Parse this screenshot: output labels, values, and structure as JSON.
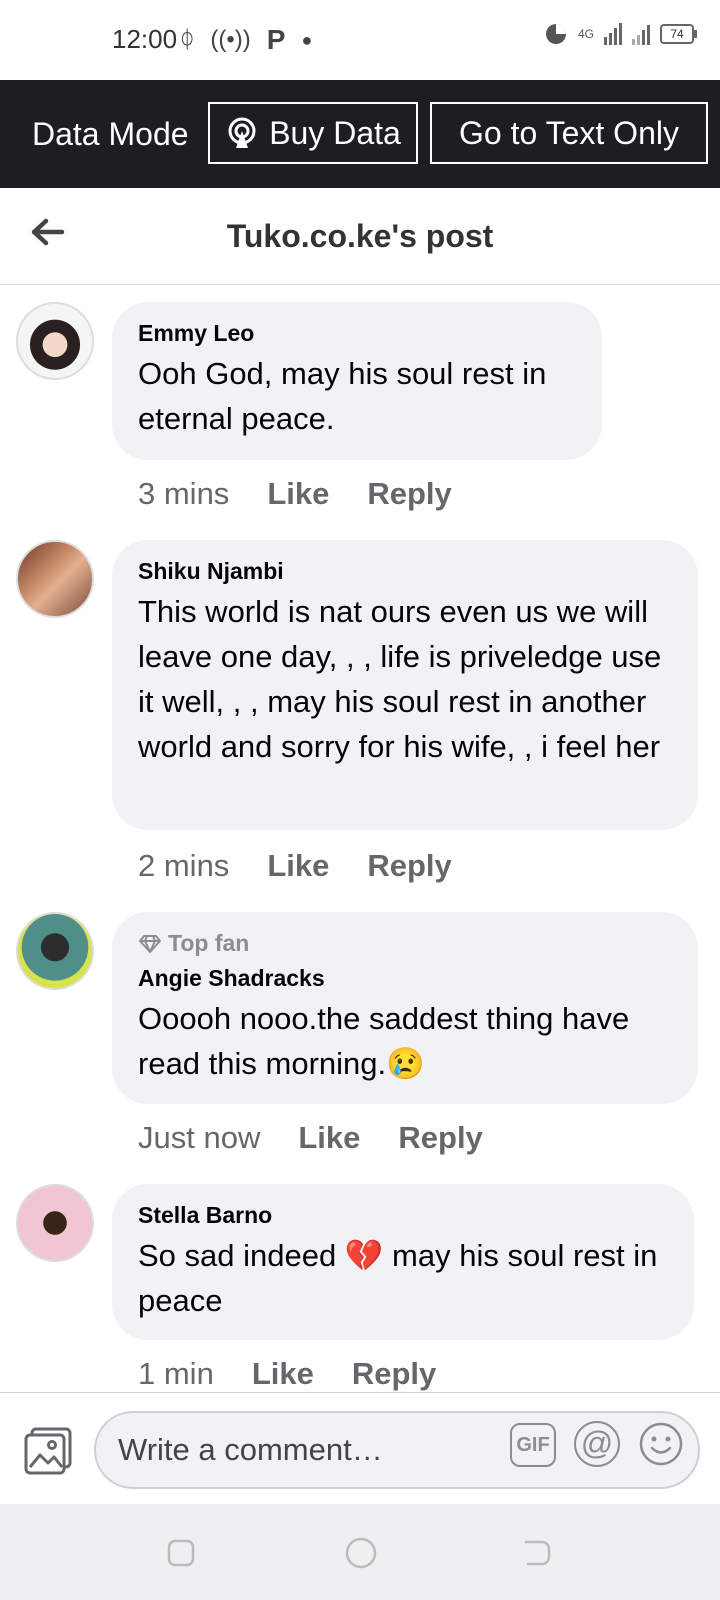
{
  "status_bar": {
    "time": "12:00",
    "battery": "74",
    "network": "4G"
  },
  "data_bar": {
    "label": "Data Mode",
    "buy_data": "Buy Data",
    "text_only": "Go to Text Only"
  },
  "header": {
    "title": "Tuko.co.ke's post"
  },
  "comments": [
    {
      "author": "Emmy Leo",
      "text": "Ooh God, may his soul rest in eternal peace.",
      "time": "3 mins",
      "like": "Like",
      "reply": "Reply"
    },
    {
      "author": "Shiku Njambi",
      "text": "This world is nat ours even us we will leave one day, , , life is priveledge use it well, , , may his soul rest in another world and sorry for his wife, , i feel her",
      "time": "2 mins",
      "like": "Like",
      "reply": "Reply"
    },
    {
      "badge": "Top fan",
      "author": "Angie Shadracks",
      "text": "Ooooh nooo.the saddest thing have read this morning.😢",
      "time": "Just now",
      "like": "Like",
      "reply": "Reply"
    },
    {
      "author": "Stella Barno",
      "text": "So sad indeed 💔 may his soul rest in peace",
      "time": "1 min",
      "like": "Like",
      "reply": "Reply"
    }
  ],
  "composer": {
    "placeholder": "Write a comment…",
    "gif": "GIF",
    "mention": "@"
  },
  "colors": {
    "data_bar": "#1c1e21",
    "bubble": "#f0f2f5",
    "meta": "#65676b"
  }
}
